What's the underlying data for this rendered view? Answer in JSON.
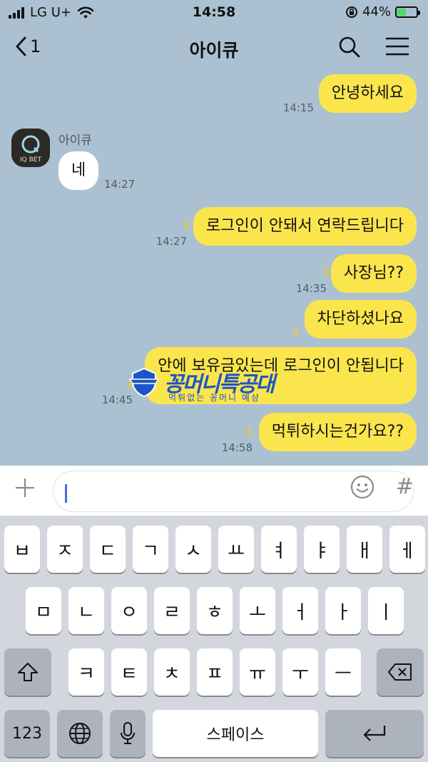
{
  "status_bar": {
    "carrier": "LG U+",
    "time": "14:58",
    "battery_percent": "44%",
    "battery_level": 0.44
  },
  "nav": {
    "back_count": "1",
    "title": "아이큐"
  },
  "chat": {
    "sender_name": "아이큐",
    "avatar_text": "IQ BET",
    "watermark_text": "꽁머니특공대",
    "watermark_sub": "먹튀없는 꽁머니 예상",
    "messages": [
      {
        "text": "안녕하세요",
        "time": "14:15",
        "unread": ""
      },
      {
        "text": "네",
        "time": "14:27",
        "unread": ""
      },
      {
        "text": "로그인이 안돼서 연락드립니다",
        "time": "14:27",
        "unread": "1"
      },
      {
        "text": "사장님??",
        "time": "14:35",
        "unread": "1"
      },
      {
        "text": "차단하셨나요",
        "time": "",
        "unread": "1"
      },
      {
        "text": "안에 보유금있는데 로그인이 안됩니다",
        "time": "14:45",
        "unread": "1"
      },
      {
        "text": "먹튀하시는건가요??",
        "time": "14:58",
        "unread": "1"
      }
    ]
  },
  "input": {
    "value": "",
    "plus_icon": "plus-icon",
    "emoji_icon": "smiley-icon",
    "hash_label": "#"
  },
  "keyboard": {
    "row1": [
      "ㅂ",
      "ㅈ",
      "ㄷ",
      "ㄱ",
      "ㅅ",
      "ㅛ",
      "ㅕ",
      "ㅑ",
      "ㅐ",
      "ㅔ"
    ],
    "row2": [
      "ㅁ",
      "ㄴ",
      "ㅇ",
      "ㄹ",
      "ㅎ",
      "ㅗ",
      "ㅓ",
      "ㅏ",
      "ㅣ"
    ],
    "row3": [
      "ㅋ",
      "ㅌ",
      "ㅊ",
      "ㅍ",
      "ㅠ",
      "ㅜ",
      "ㅡ"
    ],
    "numbers_label": "123",
    "space_label": "스페이스",
    "colors": {
      "key": "#ffffff",
      "dark_key": "#adb3bc",
      "background": "#d3d6dd"
    }
  },
  "colors": {
    "chat_background": "#abc1d1",
    "outgoing_bubble": "#fbe54d",
    "incoming_bubble": "#ffffff",
    "unread": "#e9c834"
  }
}
